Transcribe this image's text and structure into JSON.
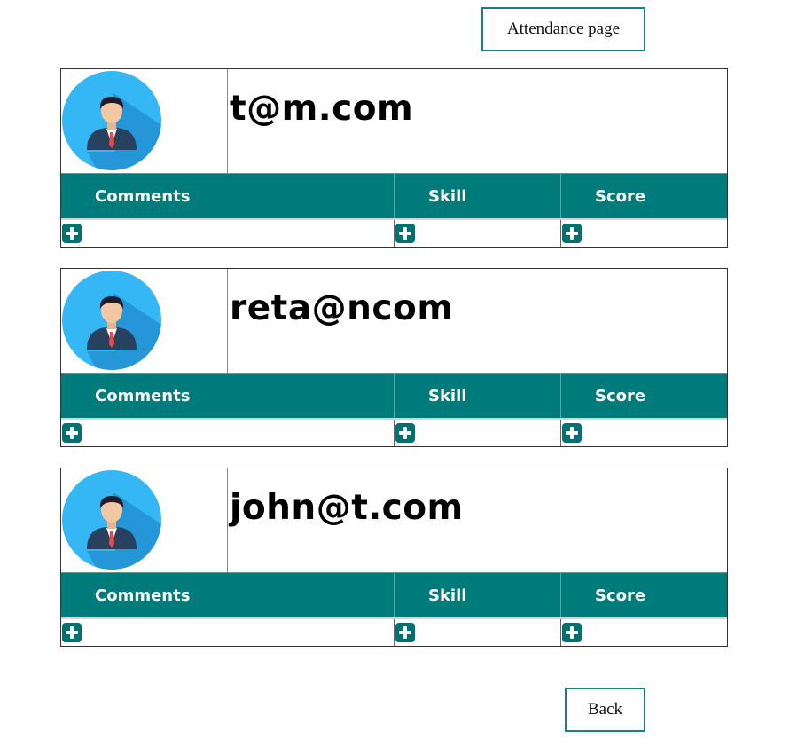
{
  "header": {
    "attendance_label": "Attendance page"
  },
  "columns": {
    "comments": "Comments",
    "skill": "Skill",
    "score": "Score"
  },
  "users": [
    {
      "email": "t@m.com"
    },
    {
      "email": "reta@ncom"
    },
    {
      "email": "john@t.com"
    }
  ],
  "footer": {
    "back_label": "Back"
  },
  "colors": {
    "accent": "#007b7b",
    "avatar_bg": "#35b6f5",
    "button_border": "#1b7f86"
  }
}
